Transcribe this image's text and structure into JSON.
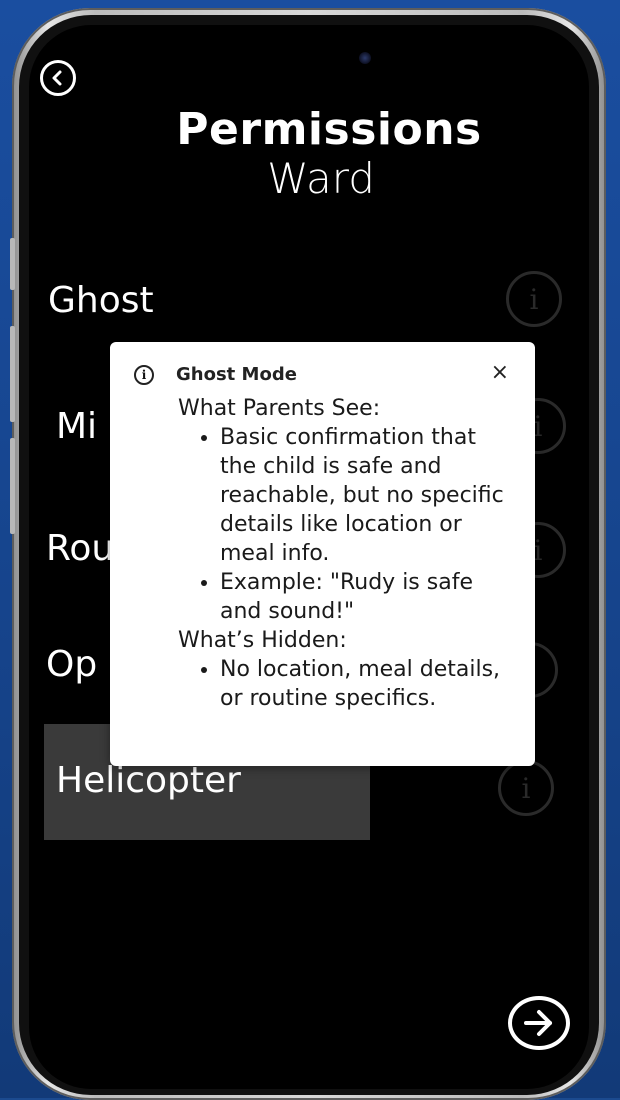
{
  "header": {
    "title": "Permissions",
    "subtitle": "Ward"
  },
  "modes": [
    {
      "label": "Ghost"
    },
    {
      "label": "Mi"
    },
    {
      "label": "Rou"
    },
    {
      "label": "Op"
    },
    {
      "label": "Helicopter"
    }
  ],
  "tooltip": {
    "title": "Ghost Mode",
    "close_label": "×",
    "parents_heading": "What Parents See:",
    "parents_items": [
      "Basic confirmation that the child is safe and reachable, but no specific details like location or meal info.",
      "Example: \"Rudy is safe and sound!\""
    ],
    "hidden_heading": "What’s Hidden:",
    "hidden_items": [
      "No location, meal details, or routine specifics."
    ]
  },
  "icons": {
    "info": "info-icon",
    "back": "back-arrow-icon",
    "next": "next-arrow-icon",
    "close": "close-icon"
  },
  "colors": {
    "background": "#1a4ea0",
    "screen": "#000000",
    "selected_row": "#3a3a3a",
    "text": "#ffffff"
  }
}
